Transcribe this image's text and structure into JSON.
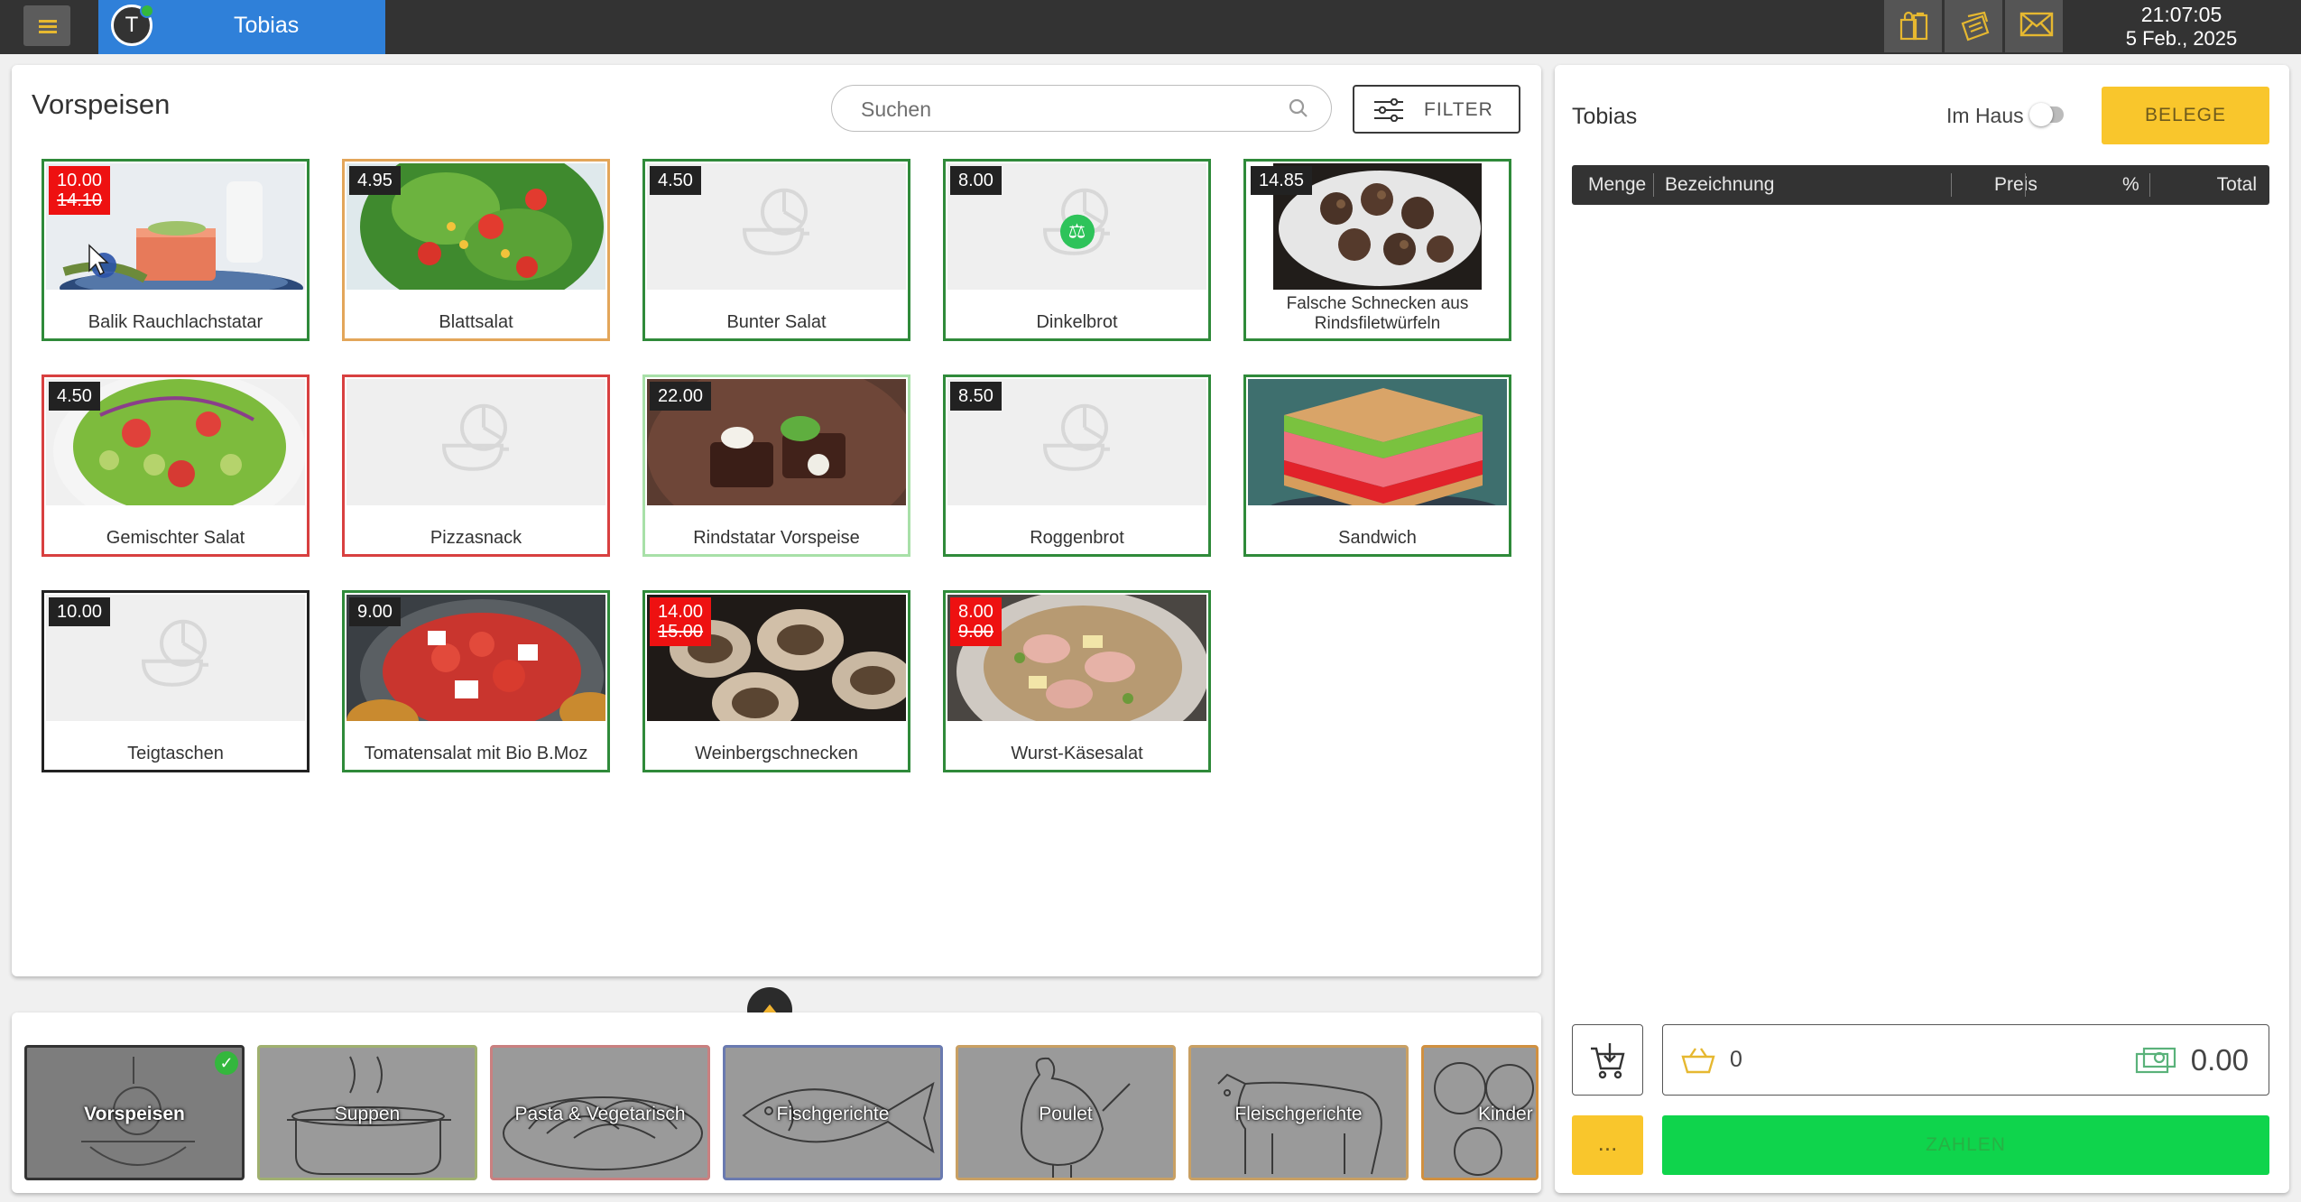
{
  "topbar": {
    "user_initial": "T",
    "user_name": "Tobias",
    "time": "21:07:05",
    "date": "5 Feb., 2025",
    "icons": [
      "shopping-bags-icon",
      "receipt-stack-icon",
      "mail-icon"
    ],
    "accent": "#2f80d9",
    "icon_color": "#e6b830"
  },
  "products": {
    "category_title": "Vorspeisen",
    "search_placeholder": "Suchen",
    "filter_label": "FILTER",
    "items": [
      {
        "name": "Balik Rauchlachstatar",
        "price": "10.00",
        "old_price": "14.10",
        "promo": true,
        "image": "salmon-tartare"
      },
      {
        "name": "Blattsalat",
        "price": "4.95",
        "image": "leaf-salad"
      },
      {
        "name": "Bunter Salat",
        "price": "4.50",
        "image": "placeholder"
      },
      {
        "name": "Dinkelbrot",
        "price": "8.00",
        "image": "placeholder",
        "badge": "scale-icon"
      },
      {
        "name": "Falsche Schnecken aus Rindsfiletwürfeln",
        "price": "14.85",
        "image": "escargot-beef"
      },
      {
        "name": "Gemischter Salat",
        "price": "4.50",
        "image": "mixed-salad"
      },
      {
        "name": "Pizzasnack",
        "price": "",
        "image": "placeholder"
      },
      {
        "name": "Rindstatar Vorspeise",
        "price": "22.00",
        "image": "beef-tartare"
      },
      {
        "name": "Roggenbrot",
        "price": "8.50",
        "image": "placeholder"
      },
      {
        "name": "Sandwich",
        "price": "",
        "image": "sandwich"
      },
      {
        "name": "Teigtaschen",
        "price": "10.00",
        "image": "placeholder"
      },
      {
        "name": "Tomatensalat mit Bio B.Moz",
        "price": "9.00",
        "image": "tomato-salad"
      },
      {
        "name": "Weinbergschnecken",
        "price": "14.00",
        "old_price": "15.00",
        "promo": true,
        "image": "snails"
      },
      {
        "name": "Wurst-Käsesalat",
        "price": "8.00",
        "old_price": "9.00",
        "promo": true,
        "image": "sausage-salad"
      }
    ]
  },
  "categories": [
    {
      "label": "Vorspeisen",
      "active": true
    },
    {
      "label": "Suppen"
    },
    {
      "label": "Pasta & Vegetarisch"
    },
    {
      "label": "Fischgerichte"
    },
    {
      "label": "Poulet"
    },
    {
      "label": "Fleischgerichte"
    },
    {
      "label": "Kinder"
    }
  ],
  "receipt": {
    "user": "Tobias",
    "inhouse_label": "Im Haus",
    "inhouse_on": false,
    "belege_label": "BELEGE",
    "columns": {
      "qty": "Menge",
      "desc": "Bezeichnung",
      "price": "Preis",
      "pct": "%",
      "total": "Total"
    },
    "item_count": "0",
    "total": "0.00",
    "more_label": "...",
    "pay_label": "ZAHLEN",
    "pay_color": "#0fd44c",
    "belege_color": "#f9c62c"
  }
}
